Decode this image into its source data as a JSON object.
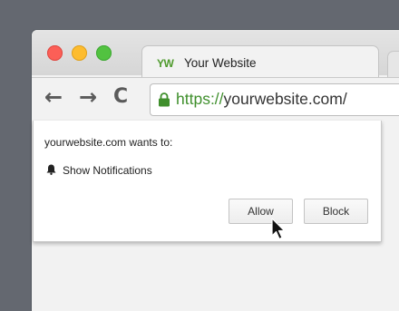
{
  "browser": {
    "tab": {
      "logo_text": "YW",
      "title": "Your Website"
    },
    "toolbar": {
      "back_glyph": "←",
      "forward_glyph": "→",
      "reload_glyph": "C",
      "url_scheme": "https://",
      "url_host": "yourwebsite.com/"
    }
  },
  "permission_prompt": {
    "message": "yourwebsite.com wants to:",
    "permission_label": "Show Notifications",
    "allow_label": "Allow",
    "block_label": "Block"
  },
  "icons": {
    "lock": "lock-icon",
    "bell": "bell-icon",
    "cursor": "mouse-cursor-icon"
  },
  "colors": {
    "secure_green": "#3f8f2c",
    "logo_green": "#4e9a2c",
    "close_red": "#fc5f57",
    "minimize_yellow": "#fdbc2e",
    "maximize_green": "#52c240"
  }
}
